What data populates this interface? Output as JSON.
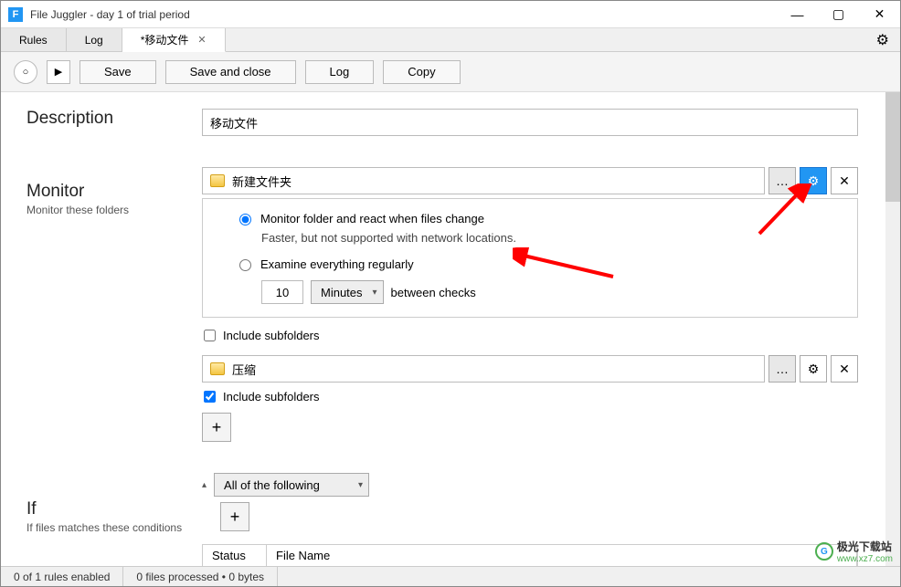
{
  "window": {
    "title": "File Juggler - day 1 of trial period",
    "app_icon_letter": "F"
  },
  "tabs": [
    {
      "label": "Rules",
      "active": false,
      "closable": false
    },
    {
      "label": "Log",
      "active": false,
      "closable": false
    },
    {
      "label": "*移动文件",
      "active": true,
      "closable": true
    }
  ],
  "toolbar": {
    "save": "Save",
    "save_and_close": "Save and close",
    "log": "Log",
    "copy": "Copy"
  },
  "sections": {
    "description": {
      "title": "Description"
    },
    "monitor": {
      "title": "Monitor",
      "subtitle": "Monitor these folders"
    },
    "if": {
      "title": "If",
      "subtitle": "If files matches these conditions"
    }
  },
  "description_value": "移动文件",
  "monitor": {
    "folders": [
      {
        "path": "新建文件夹",
        "expanded": true,
        "gear_active": true,
        "option_selected": "monitor",
        "option_monitor_label": "Monitor folder and react when files change",
        "option_monitor_sub": "Faster, but not supported with network locations.",
        "option_examine_label": "Examine everything regularly",
        "interval_value": "10",
        "interval_unit": "Minutes",
        "interval_suffix": "between checks",
        "include_subfolders": false,
        "include_subfolders_label": "Include subfolders"
      },
      {
        "path": "压缩",
        "expanded": false,
        "gear_active": false,
        "include_subfolders": true,
        "include_subfolders_label": "Include subfolders"
      }
    ]
  },
  "if": {
    "condition_select": "All of the following",
    "table_headers": {
      "status": "Status",
      "filename": "File Name"
    }
  },
  "statusbar": {
    "rules": "0 of 1 rules enabled",
    "files": "0 files processed • 0 bytes"
  },
  "watermark": {
    "brand": "极光下载站",
    "url": "www.xz7.com"
  }
}
